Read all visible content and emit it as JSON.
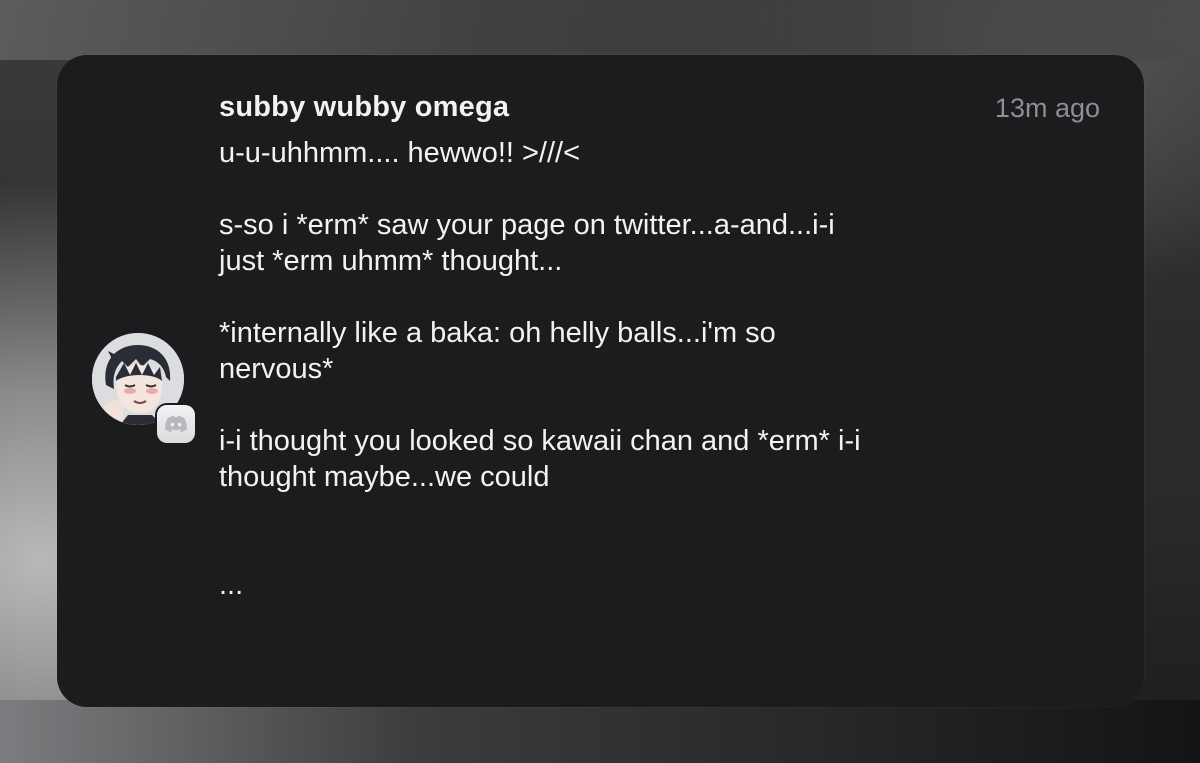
{
  "notification": {
    "sender": "subby wubby omega",
    "timestamp": "13m ago",
    "app_icon": "discord-icon",
    "avatar": "anime-character-avatar",
    "message_lines": [
      "u-u-uhhmm.... hewwo!! >///<",
      "",
      "s-so i *erm* saw your page on twitter...a-and...i-i",
      "just *erm uhmm* thought...",
      "",
      "*internally like a baka: oh helly balls...i'm so",
      "nervous*",
      "",
      "i-i thought you looked so kawaii chan and *erm* i-i",
      "thought maybe...we could",
      "",
      "",
      "..."
    ]
  },
  "colors": {
    "card_background": "#1c1c1e",
    "primary_text": "#f2f2f4",
    "secondary_text": "#8e8e93"
  }
}
